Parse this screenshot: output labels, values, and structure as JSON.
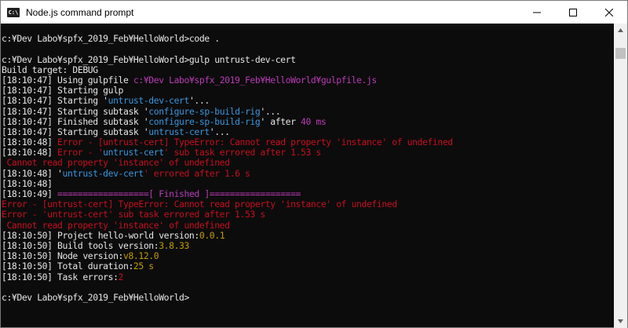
{
  "window": {
    "title": "Node.js command prompt",
    "app_icon_text": "C:\\",
    "icons": {
      "minimize": "minimize-icon",
      "maximize": "maximize-icon",
      "close": "close-icon"
    }
  },
  "colors": {
    "background": "#0c0c0c",
    "default_text": "#cccccc",
    "cyan": "#3a96dd",
    "magenta": "#b93bb5",
    "red": "#c50f1f",
    "yellow": "#c19c00",
    "white": "#e6e6e6"
  },
  "console": {
    "lines": [
      [
        {
          "text": ""
        }
      ],
      [
        {
          "text": "c:¥Dev Labo¥spfx_2019_Feb¥HelloWorld>code .",
          "color": "#e6e6e6"
        }
      ],
      [
        {
          "text": ""
        }
      ],
      [
        {
          "text": "c:¥Dev Labo¥spfx_2019_Feb¥HelloWorld>gulp untrust-dev-cert",
          "color": "#e6e6e6"
        }
      ],
      [
        {
          "text": "Build target: DEBUG",
          "color": "#e6e6e6"
        }
      ],
      [
        {
          "text": "[18:10:47] Using gulpfile ",
          "color": "#e6e6e6"
        },
        {
          "text": "c:¥Dev Labo¥spfx_2019_Feb¥HelloWorld¥gulpfile.js",
          "color": "#b93bb5"
        }
      ],
      [
        {
          "text": "[18:10:47] Starting gulp",
          "color": "#e6e6e6"
        }
      ],
      [
        {
          "text": "[18:10:47] Starting '",
          "color": "#e6e6e6"
        },
        {
          "text": "untrust-dev-cert",
          "color": "#3a96dd"
        },
        {
          "text": "'...",
          "color": "#e6e6e6"
        }
      ],
      [
        {
          "text": "[18:10:47] Starting subtask '",
          "color": "#e6e6e6"
        },
        {
          "text": "configure-sp-build-rig",
          "color": "#3a96dd"
        },
        {
          "text": "'...",
          "color": "#e6e6e6"
        }
      ],
      [
        {
          "text": "[18:10:47] Finished subtask '",
          "color": "#e6e6e6"
        },
        {
          "text": "configure-sp-build-rig",
          "color": "#3a96dd"
        },
        {
          "text": "' after ",
          "color": "#e6e6e6"
        },
        {
          "text": "40 ms",
          "color": "#b93bb5"
        }
      ],
      [
        {
          "text": "[18:10:47] Starting subtask '",
          "color": "#e6e6e6"
        },
        {
          "text": "untrust-cert",
          "color": "#3a96dd"
        },
        {
          "text": "'...",
          "color": "#e6e6e6"
        }
      ],
      [
        {
          "text": "[18:10:48] ",
          "color": "#e6e6e6"
        },
        {
          "text": "Error - [untrust-cert] TypeError: Cannot read property 'instance' of undefined",
          "color": "#c50f1f"
        }
      ],
      [
        {
          "text": "[18:10:48] ",
          "color": "#e6e6e6"
        },
        {
          "text": "Error - '",
          "color": "#c50f1f"
        },
        {
          "text": "untrust-cert",
          "color": "#3a96dd"
        },
        {
          "text": "' sub task errored after 1.53 s",
          "color": "#c50f1f"
        }
      ],
      [
        {
          "text": " Cannot read property 'instance' of undefined",
          "color": "#c50f1f"
        }
      ],
      [
        {
          "text": "[18:10:48] '",
          "color": "#e6e6e6"
        },
        {
          "text": "untrust-dev-cert",
          "color": "#3a96dd"
        },
        {
          "text": "' errored after 1.6 s",
          "color": "#c50f1f"
        }
      ],
      [
        {
          "text": "[18:10:48]",
          "color": "#e6e6e6"
        }
      ],
      [
        {
          "text": "[18:10:49] ",
          "color": "#e6e6e6"
        },
        {
          "text": "==================[ Finished ]==================",
          "color": "#b93bb5"
        }
      ],
      [
        {
          "text": "Error - [untrust-cert] TypeError: Cannot read property 'instance' of undefined",
          "color": "#c50f1f"
        }
      ],
      [
        {
          "text": "Error - 'untrust-cert' sub task errored after 1.53 s",
          "color": "#c50f1f"
        }
      ],
      [
        {
          "text": " Cannot read property 'instance' of undefined",
          "color": "#c50f1f"
        }
      ],
      [
        {
          "text": "[18:10:50] Project hello-world version:",
          "color": "#e6e6e6"
        },
        {
          "text": "0.0.1",
          "color": "#c19c00"
        }
      ],
      [
        {
          "text": "[18:10:50] Build tools version:",
          "color": "#e6e6e6"
        },
        {
          "text": "3.8.33",
          "color": "#c19c00"
        }
      ],
      [
        {
          "text": "[18:10:50] Node version:",
          "color": "#e6e6e6"
        },
        {
          "text": "v8.12.0",
          "color": "#c19c00"
        }
      ],
      [
        {
          "text": "[18:10:50] Total duration:",
          "color": "#e6e6e6"
        },
        {
          "text": "25 s",
          "color": "#c19c00"
        }
      ],
      [
        {
          "text": "[18:10:50] Task errors:",
          "color": "#e6e6e6"
        },
        {
          "text": "2",
          "color": "#c50f1f"
        }
      ],
      [
        {
          "text": ""
        }
      ],
      [
        {
          "text": "c:¥Dev Labo¥spfx_2019_Feb¥HelloWorld>",
          "color": "#e6e6e6"
        }
      ]
    ]
  },
  "scrollbar": {
    "icons": {
      "up": "scroll-up-arrow-icon",
      "down": "scroll-down-arrow-icon"
    },
    "position": 0.04
  }
}
